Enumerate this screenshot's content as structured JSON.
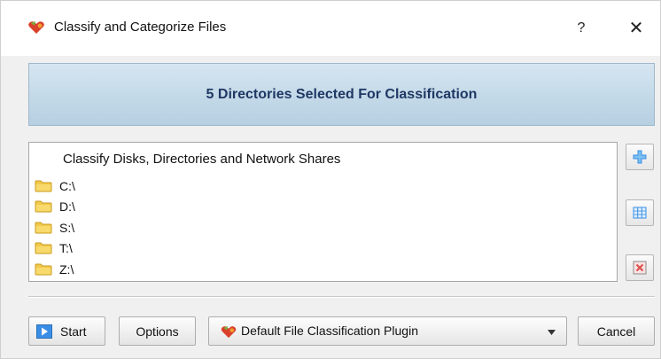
{
  "window": {
    "title": "Classify and Categorize Files",
    "help_label": "?",
    "close_label": "✕"
  },
  "banner": {
    "text": "5 Directories Selected For Classification"
  },
  "list": {
    "header": "Classify Disks, Directories and Network Shares",
    "items": [
      {
        "label": "C:\\",
        "icon": "folder-icon"
      },
      {
        "label": "D:\\",
        "icon": "folder-icon"
      },
      {
        "label": "S:\\",
        "icon": "folder-icon"
      },
      {
        "label": "T:\\",
        "icon": "folder-icon"
      },
      {
        "label": "Z:\\",
        "icon": "folder-icon"
      }
    ]
  },
  "side_buttons": [
    {
      "name": "add-directory-button",
      "icon": "plus-icon"
    },
    {
      "name": "edit-directories-button",
      "icon": "grid-icon"
    },
    {
      "name": "remove-directory-button",
      "icon": "delete-icon"
    }
  ],
  "footer": {
    "start_label": "Start",
    "options_label": "Options",
    "plugin_selected": "Default File Classification Plugin",
    "cancel_label": "Cancel"
  },
  "colors": {
    "banner_text": "#1f3864",
    "banner_bg": "#c3d9e8",
    "folder": "#f2c94c",
    "accent_blue": "#3a8ee6",
    "delete_red": "#d9534f"
  }
}
